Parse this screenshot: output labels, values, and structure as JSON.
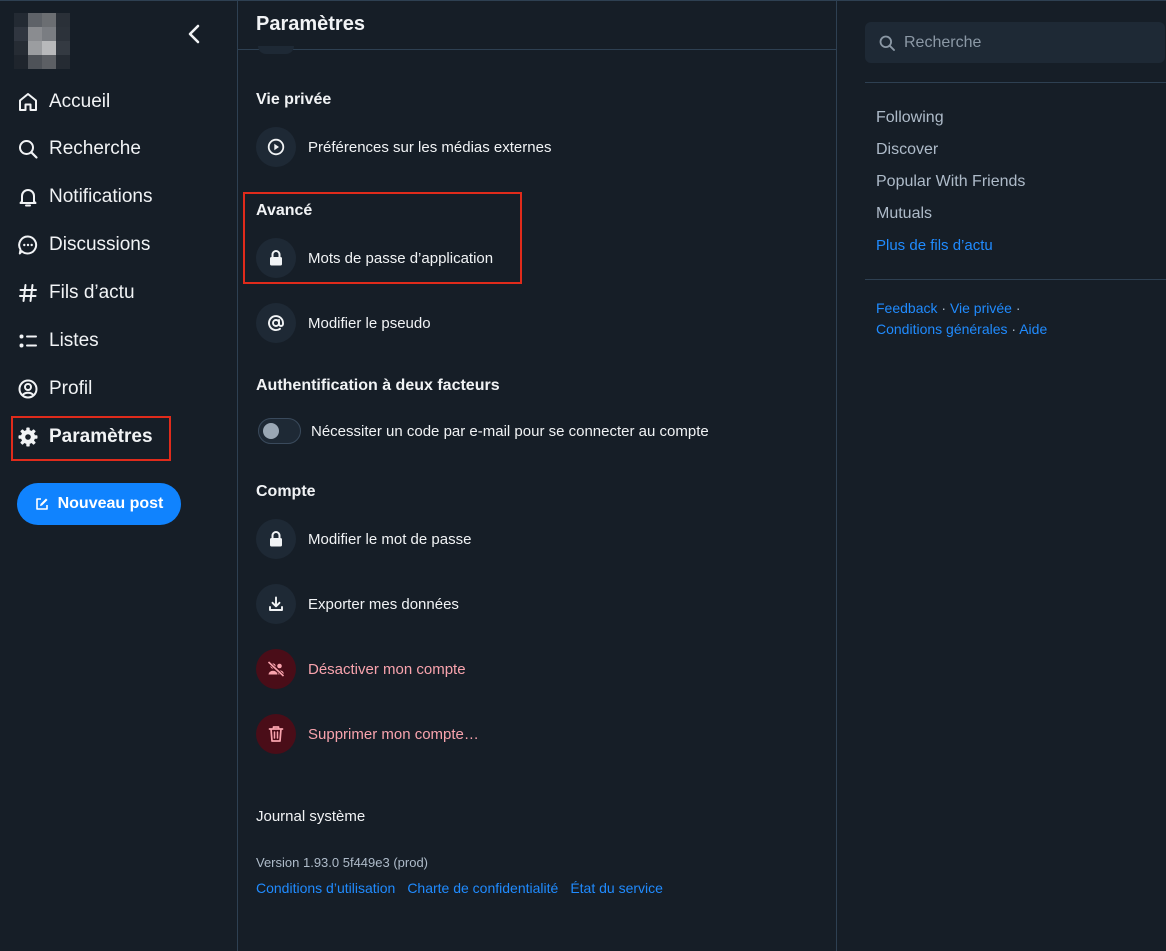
{
  "colors": {
    "background": "#161e27",
    "accent": "#1083fe",
    "link": "#208bfe",
    "danger_text": "#f8a3ad",
    "danger_bg": "#4a0d18",
    "highlight_box": "#e02b1b"
  },
  "sidebar": {
    "avatar_icon": "avatar-icon",
    "collapse_icon": "chevron-left-icon",
    "items": [
      {
        "label": "Accueil",
        "icon": "home-icon"
      },
      {
        "label": "Recherche",
        "icon": "search-icon"
      },
      {
        "label": "Notifications",
        "icon": "bell-icon"
      },
      {
        "label": "Discussions",
        "icon": "chat-bubble-icon"
      },
      {
        "label": "Fils d’actu",
        "icon": "hash-icon"
      },
      {
        "label": "Listes",
        "icon": "list-icon"
      },
      {
        "label": "Profil",
        "icon": "user-circle-icon"
      },
      {
        "label": "Paramètres",
        "icon": "gear-icon"
      }
    ],
    "new_post_label": "Nouveau post",
    "new_post_icon": "edit-icon"
  },
  "main": {
    "title": "Paramètres",
    "sections": {
      "privacy": {
        "title": "Vie privée",
        "items": [
          {
            "label": "Préférences sur les médias externes",
            "icon": "play-circle-icon"
          }
        ]
      },
      "advanced": {
        "title": "Avancé",
        "items": [
          {
            "label": "Mots de passe d’application",
            "icon": "lock-icon"
          },
          {
            "label": "Modifier le pseudo",
            "icon": "at-sign-icon"
          }
        ]
      },
      "two_factor": {
        "title": "Authentification à deux facteurs",
        "toggle_label": "Nécessiter un code par e-mail pour se connecter au compte",
        "toggle_on": false
      },
      "account": {
        "title": "Compte",
        "items": [
          {
            "label": "Modifier le mot de passe",
            "icon": "lock-icon"
          },
          {
            "label": "Exporter mes données",
            "icon": "download-icon"
          },
          {
            "label": "Désactiver mon compte",
            "icon": "users-slash-icon"
          },
          {
            "label": "Supprimer mon compte…",
            "icon": "trash-icon"
          }
        ]
      }
    },
    "system_log": "Journal système",
    "version": "Version 1.93.0 5f449e3 (prod)",
    "footer_links": [
      "Conditions d’utilisation",
      "Charte de confidentialité",
      "État du service"
    ]
  },
  "right": {
    "search_placeholder": "Recherche",
    "feeds": [
      "Following",
      "Discover",
      "Popular With Friends",
      "Mutuals"
    ],
    "more_feeds": "Plus de fils d’actu",
    "links": {
      "feedback": "Feedback",
      "privacy": "Vie privée",
      "terms": "Conditions générales",
      "help": "Aide",
      "separator": "·"
    }
  }
}
